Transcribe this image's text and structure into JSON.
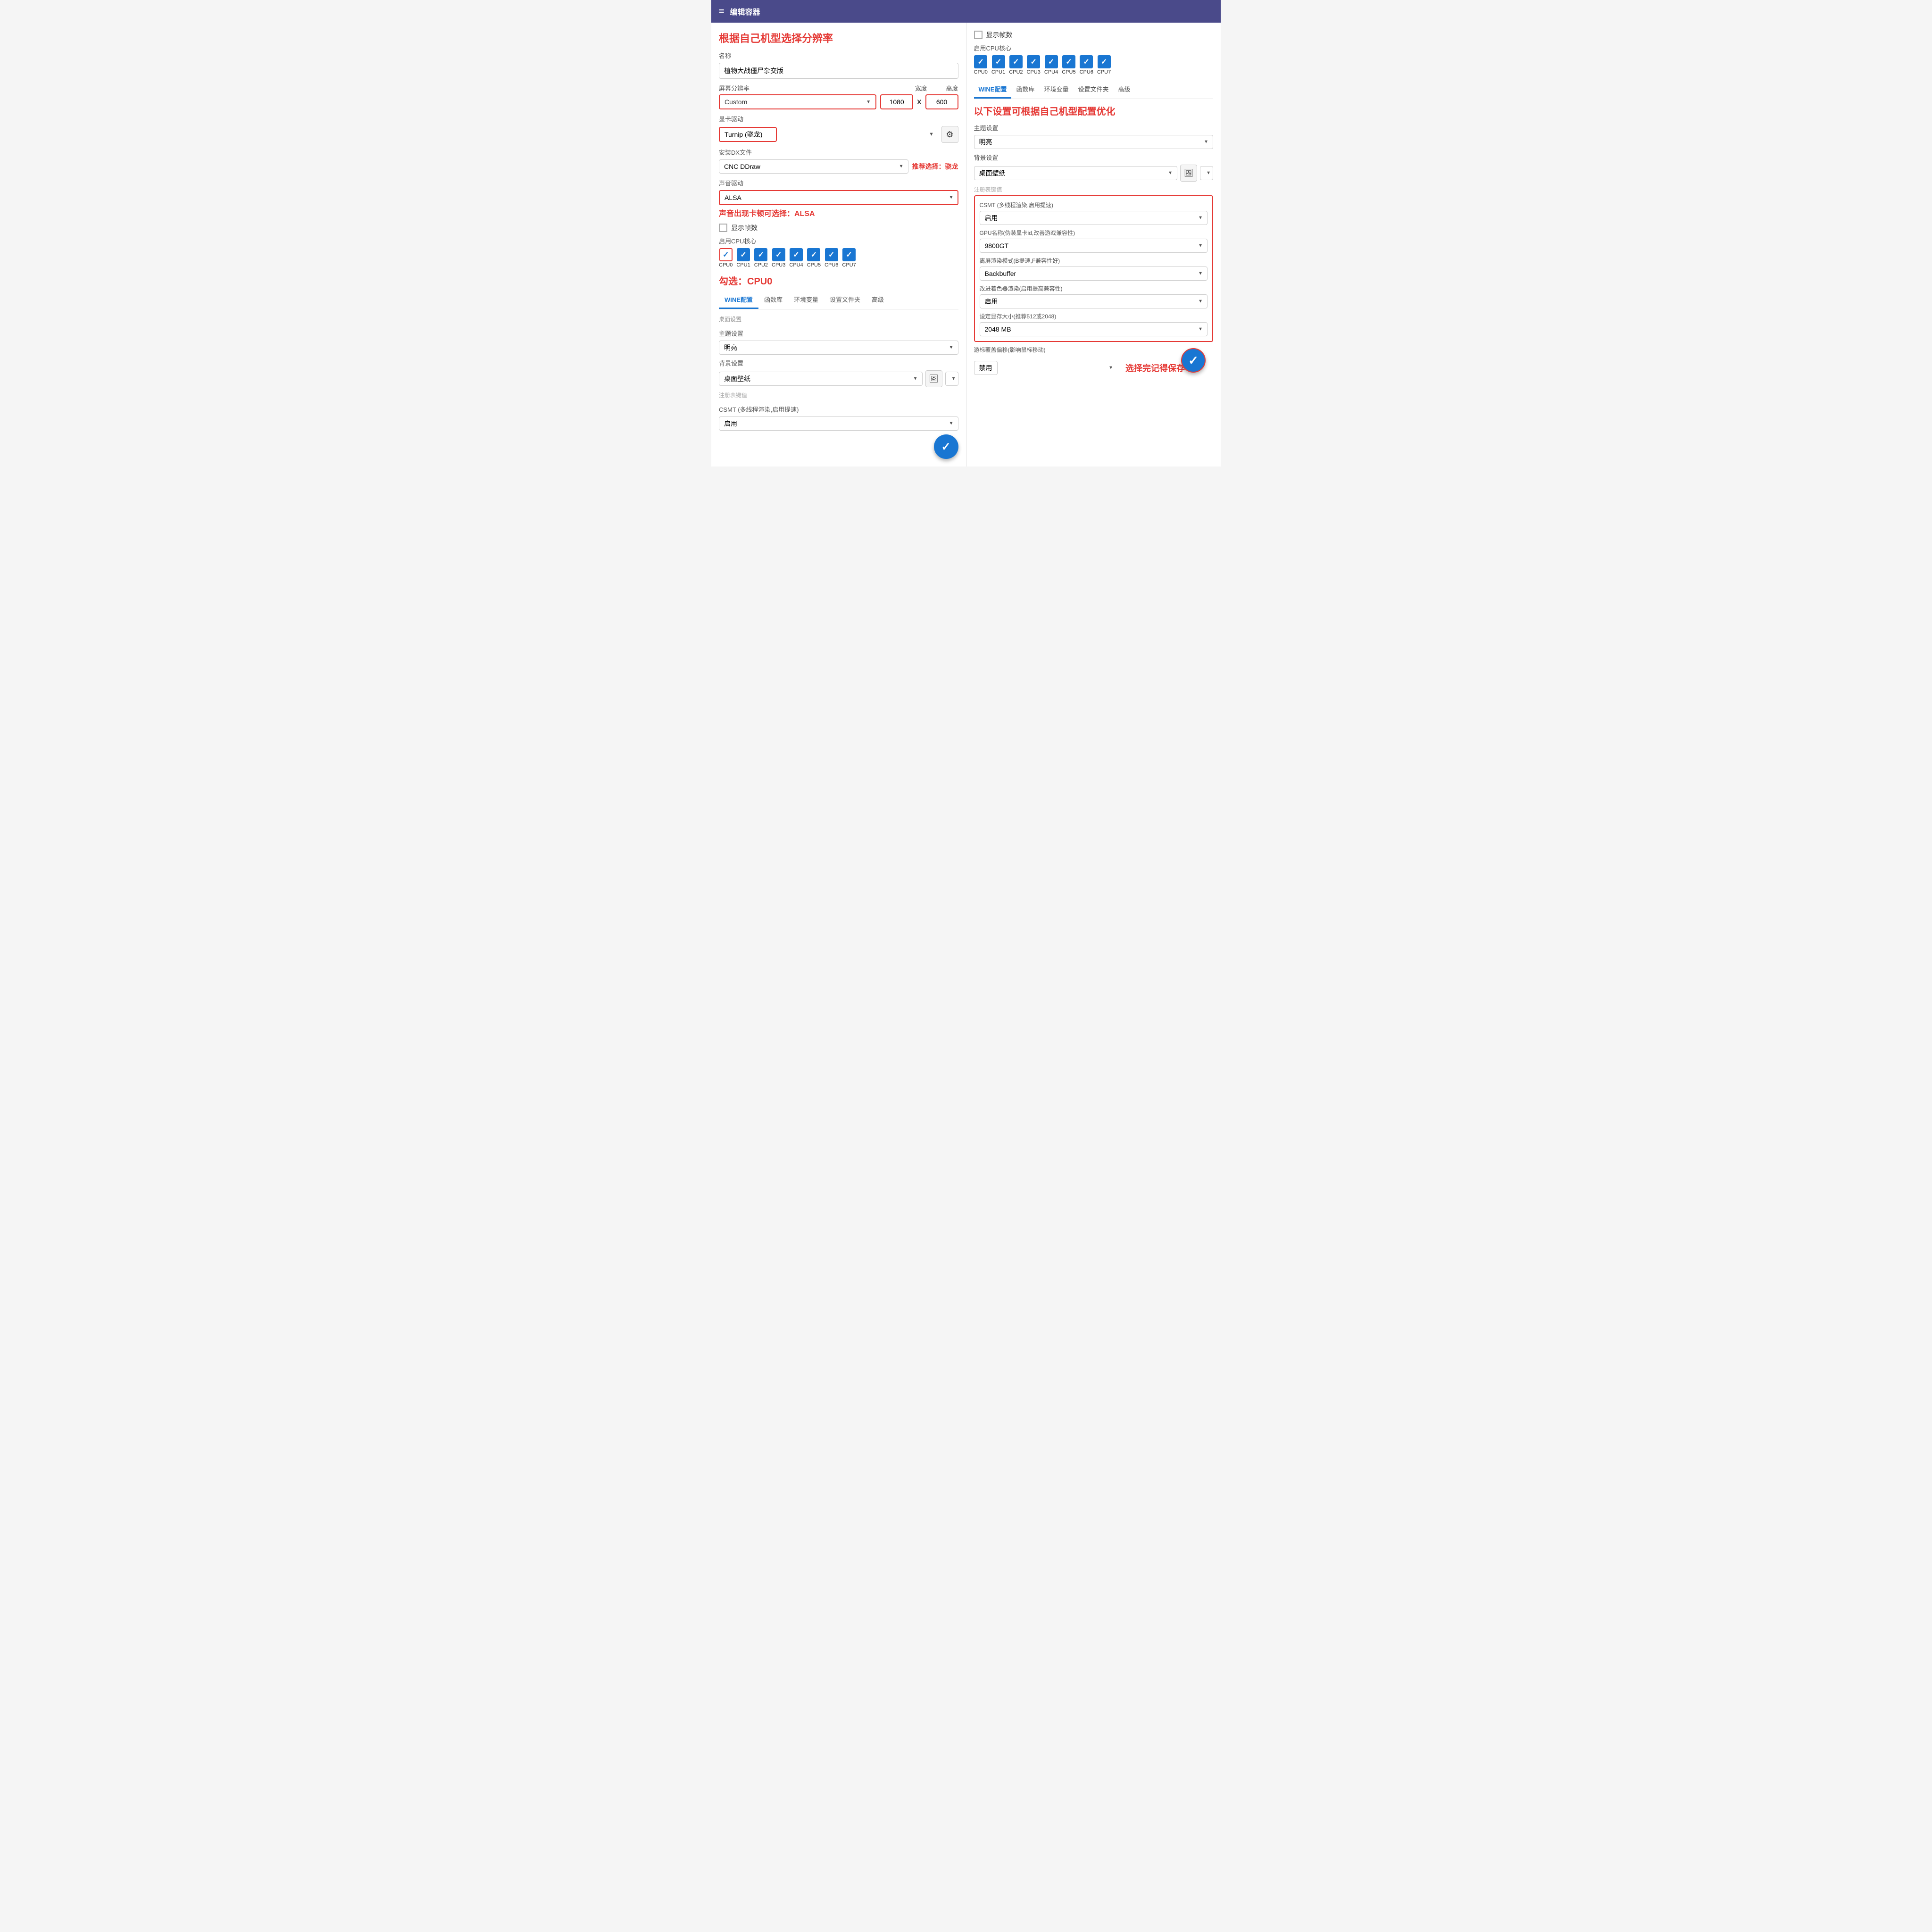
{
  "header": {
    "title": "编辑容器",
    "menu_icon": "≡"
  },
  "left": {
    "annotation1": "根据自己机型选择分辨率",
    "name_label": "名称",
    "name_value": "植物大战僵尸杂交版",
    "resolution_label": "屏幕分辨率",
    "resolution_width_label": "宽度",
    "resolution_height_label": "高度",
    "resolution_preset": "Custom",
    "resolution_width": "1080",
    "resolution_height": "600",
    "gpu_label": "显卡驱动",
    "gpu_value": "Turnip (骁龙)",
    "dx_label": "安装DX文件",
    "dx_value": "CNC DDraw",
    "dx_annotation": "推荐选择：骁龙",
    "audio_label": "声音驱动",
    "audio_value": "ALSA",
    "audio_annotation": "声音出现卡顿可选择：ALSA",
    "show_fps_label": "显示帧数",
    "cpu_label": "启用CPU核心",
    "cpu_items": [
      {
        "id": "CPU0",
        "checked": true,
        "outlined": true
      },
      {
        "id": "CPU1",
        "checked": true,
        "outlined": false
      },
      {
        "id": "CPU2",
        "checked": true,
        "outlined": false
      },
      {
        "id": "CPU3",
        "checked": true,
        "outlined": false
      },
      {
        "id": "CPU4",
        "checked": true,
        "outlined": false
      },
      {
        "id": "CPU5",
        "checked": true,
        "outlined": false
      },
      {
        "id": "CPU6",
        "checked": true,
        "outlined": false
      },
      {
        "id": "CPU7",
        "checked": true,
        "outlined": false
      }
    ],
    "cpu_annotation": "勾选：CPU0",
    "tabs": [
      "WINE配置",
      "函数库",
      "环境变量",
      "设置文件夹",
      "高级"
    ],
    "active_tab": "WINE配置",
    "desktop_label": "桌面设置",
    "theme_label": "主题设置",
    "theme_value": "明亮",
    "bg_label": "背景设置",
    "bg_value": "桌面壁纸",
    "reg_label": "注册表键值",
    "csmt_label_left": "CSMT (多线程渲染,启用提速)",
    "csmt_value_left": "启用"
  },
  "right": {
    "show_fps_label": "显示帧数",
    "cpu_label": "启用CPU核心",
    "cpu_items": [
      {
        "id": "CPU0",
        "checked": true
      },
      {
        "id": "CPU1",
        "checked": true
      },
      {
        "id": "CPU2",
        "checked": true
      },
      {
        "id": "CPU3",
        "checked": true
      },
      {
        "id": "CPU4",
        "checked": true
      },
      {
        "id": "CPU5",
        "checked": true
      },
      {
        "id": "CPU6",
        "checked": true
      },
      {
        "id": "CPU7",
        "checked": true
      }
    ],
    "tabs": [
      "WINE配置",
      "函数库",
      "环境变量",
      "设置文件夹",
      "高级"
    ],
    "active_tab": "WINE配置",
    "annotation2": "以下设置可根据自己机型配置优化",
    "theme_label": "主题设置",
    "theme_value": "明亮",
    "bg_label": "背景设置",
    "bg_value": "桌面壁纸",
    "reg_label": "注册表键值",
    "csmt_label": "CSMT (多线程渲染,启用提速)",
    "csmt_value": "启用",
    "gpu_name_label": "GPU名称(伪装显卡id,改善游戏兼容性)",
    "gpu_name_value": "9800GT",
    "offscreen_label": "离屏渲染模式(B提速,F兼容性好)",
    "offscreen_value": "Backbuffer",
    "shader_label": "改进着色器渲染(启用提高兼容性)",
    "shader_value": "启用",
    "vram_label": "设定显存大小(推荐512或2048)",
    "vram_value": "2048 MB",
    "cursor_label": "游标覆盖偏移(影响鼠标移动)",
    "cursor_value": "禁用",
    "save_annotation": "选择完记得保存",
    "save_btn_label": "✓"
  }
}
